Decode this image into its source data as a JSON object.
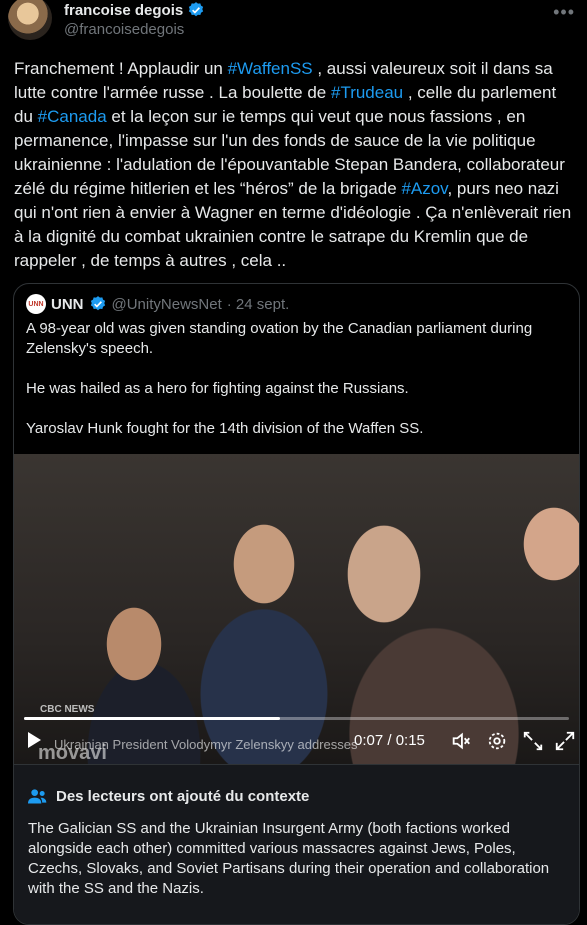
{
  "author": {
    "name": "francoise degois",
    "handle": "@francoisedegois"
  },
  "tweet": {
    "segments": [
      {
        "text": "Franchement ! Applaudir un  ",
        "tag": false
      },
      {
        "text": "#WaffenSS",
        "tag": true
      },
      {
        "text": " , aussi valeureux soit il dans sa lutte contre l'armée russe . La boulette de ",
        "tag": false
      },
      {
        "text": "#Trudeau",
        "tag": true
      },
      {
        "text": " , celle du parlement du ",
        "tag": false
      },
      {
        "text": "#Canada",
        "tag": true
      },
      {
        "text": " et la leçon sur ie temps qui veut que nous fassions ,  en permanence,  l'impasse sur l'un des  fonds de sauce de la vie politique ukrainienne : l'adulation de l'épouvantable Stepan Bandera, collaborateur zélé du  régime hitlerien   et les “héros” de la brigade ",
        "tag": false
      },
      {
        "text": "#Azov",
        "tag": true
      },
      {
        "text": ", purs neo nazi qui n'ont rien à envier à Wagner en terme d'idéologie  . Ça n'enlèverait rien à la dignité du combat ukrainien contre le satrape du Kremlin que de rappeler , de temps à autres , cela ..",
        "tag": false
      }
    ]
  },
  "quote": {
    "logo_text": "UNN",
    "name": "UNN",
    "handle": "@UnityNewsNet",
    "date": "· 24 sept.",
    "text": "A 98-year old was given standing ovation by the Canadian parliament during Zelensky's speech.\n\nHe was hailed as a hero for fighting against the Russians.\n\nYaroslav Hunk fought for the 14th division of the Waffen SS.",
    "video": {
      "time": "0:07 / 0:15",
      "progress": 0.47,
      "caption": "Ukrainian President Volodymyr Zelenskyy addresses",
      "watermark": "movavi",
      "channel": "CBC NEWS"
    }
  },
  "context": {
    "heading": "Des lecteurs ont ajouté du contexte",
    "text": "The Galician SS and the Ukrainian Insurgent Army (both factions worked alongside each other) committed various massacres against Jews, Poles, Czechs, Slovaks, and Soviet Partisans during their operation and collaboration with the SS and the Nazis."
  },
  "colors": {
    "link": "#1d9bf0",
    "muted": "#71767b",
    "border": "#2f3336"
  },
  "icons": [
    "verified-badge-icon",
    "more-icon",
    "play-icon",
    "volume-off-icon",
    "settings-icon",
    "fullscreen-icon",
    "expand-icon",
    "people-icon"
  ]
}
